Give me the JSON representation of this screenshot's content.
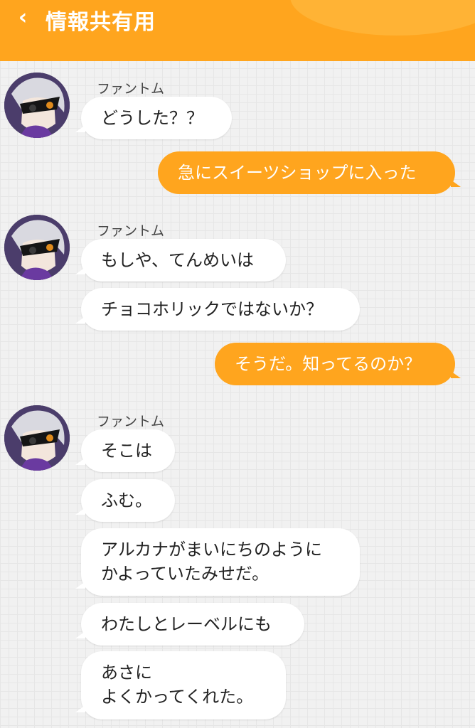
{
  "header": {
    "back_icon": "chevron-left-icon",
    "title": "情報共有用",
    "color": "#ffa51e"
  },
  "messages": {
    "group1": {
      "sender": "ファントム",
      "bubbles": [
        "どうした？？"
      ]
    },
    "mine1": "急にスイーツショップに入った",
    "group2": {
      "sender": "ファントム",
      "bubbles": [
        "もしや、てんめいは",
        "チョコホリックではないか？"
      ]
    },
    "mine2": "そうだ。知ってるのか？",
    "group3": {
      "sender": "ファントム",
      "bubbles": [
        "そこは",
        "ふむ。",
        "アルカナがまいにちのように\nかよっていたみせだ。",
        "わたしとレーベルにも",
        "あさに\nよくかってくれた。"
      ]
    }
  }
}
